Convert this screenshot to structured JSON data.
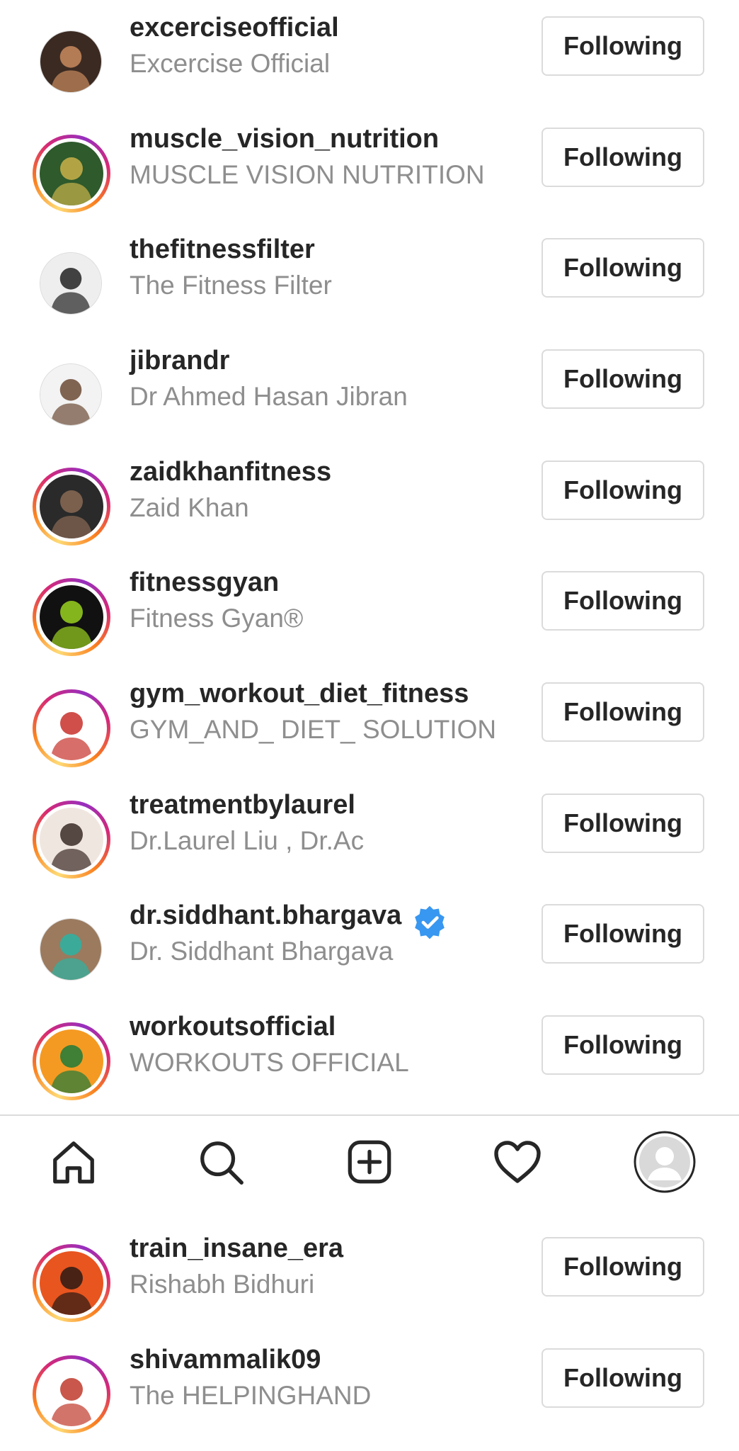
{
  "following": [
    {
      "username": "excerciseofficial",
      "fullname": "Excercise Official",
      "button": "Following",
      "story_ring": false,
      "verified": false,
      "avatar_colors": [
        "#3b2a22",
        "#c98b5e"
      ]
    },
    {
      "username": "muscle_vision_nutrition",
      "fullname": "MUSCLE VISION NUTRITION",
      "button": "Following",
      "story_ring": true,
      "verified": false,
      "avatar_colors": [
        "#2e5a2c",
        "#c9b24a"
      ]
    },
    {
      "username": "thefitnessfilter",
      "fullname": "The Fitness Filter",
      "button": "Following",
      "story_ring": false,
      "verified": false,
      "avatar_colors": [
        "#eeeeee",
        "#222222"
      ]
    },
    {
      "username": "jibrandr",
      "fullname": "Dr Ahmed Hasan Jibran",
      "button": "Following",
      "story_ring": false,
      "verified": false,
      "avatar_colors": [
        "#f3f3f3",
        "#6b4a35"
      ]
    },
    {
      "username": "zaidkhanfitness",
      "fullname": "Zaid Khan",
      "button": "Following",
      "story_ring": true,
      "verified": false,
      "avatar_colors": [
        "#2a2a2a",
        "#8a6a55"
      ]
    },
    {
      "username": "fitnessgyan",
      "fullname": "Fitness Gyan®",
      "button": "Following",
      "story_ring": true,
      "verified": false,
      "avatar_colors": [
        "#111111",
        "#9ad21e"
      ]
    },
    {
      "username": "gym_workout_diet_fitness",
      "fullname": "GYM_AND_ DIET_ SOLUTION",
      "button": "Following",
      "story_ring": true,
      "verified": false,
      "avatar_colors": [
        "#ffffff",
        "#c8302a"
      ]
    },
    {
      "username": "treatmentbylaurel",
      "fullname": "Dr.Laurel Liu , Dr.Ac",
      "button": "Following",
      "story_ring": true,
      "verified": false,
      "avatar_colors": [
        "#f0e6e0",
        "#3a2a26"
      ]
    },
    {
      "username": "dr.siddhant.bhargava",
      "fullname": "Dr. Siddhant Bhargava",
      "button": "Following",
      "story_ring": false,
      "verified": true,
      "avatar_colors": [
        "#9b7a5e",
        "#2bb3a3"
      ]
    },
    {
      "username": "workoutsofficial",
      "fullname": "WORKOUTS OFFICIAL",
      "button": "Following",
      "story_ring": true,
      "verified": false,
      "avatar_colors": [
        "#f49a22",
        "#1f7a3a"
      ]
    },
    {
      "username": "train_insane_era",
      "fullname": "Rishabh Bidhuri",
      "button": "Following",
      "story_ring": true,
      "verified": false,
      "avatar_colors": [
        "#e8551f",
        "#2a1a14"
      ]
    },
    {
      "username": "shivammalik09",
      "fullname": "The HELPINGHAND",
      "button": "Following",
      "story_ring": true,
      "verified": false,
      "avatar_colors": [
        "#ffffff",
        "#c0392b"
      ]
    }
  ],
  "navbar": {
    "items": [
      "home-icon",
      "search-icon",
      "new-post-icon",
      "activity-heart-icon",
      "profile-avatar"
    ]
  },
  "colors": {
    "verified_badge": "#3897f0",
    "button_border": "#dbdbdb",
    "secondary_text": "#8e8e8e"
  }
}
